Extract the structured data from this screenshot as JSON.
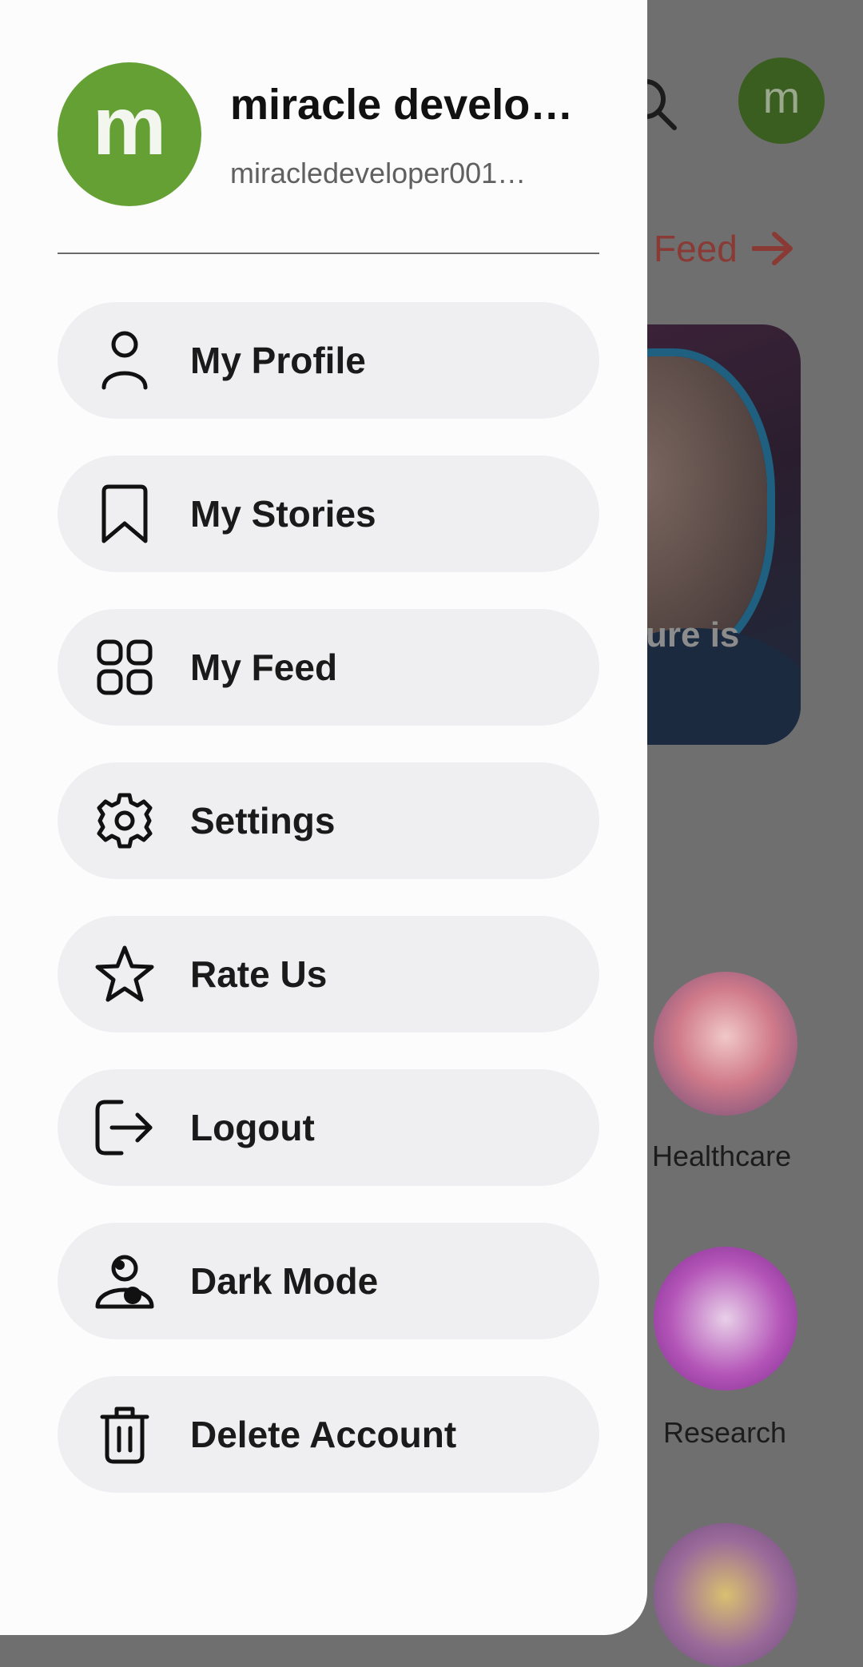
{
  "profile": {
    "avatar_letter": "m",
    "name": "miracle develo…",
    "email": "miracledeveloper001…"
  },
  "menu": [
    {
      "label": "My Profile",
      "icon": "person-icon"
    },
    {
      "label": "My Stories",
      "icon": "bookmark-icon"
    },
    {
      "label": "My Feed",
      "icon": "grid-icon"
    },
    {
      "label": "Settings",
      "icon": "gear-icon"
    },
    {
      "label": "Rate Us",
      "icon": "star-icon"
    },
    {
      "label": "Logout",
      "icon": "logout-icon"
    },
    {
      "label": "Dark Mode",
      "icon": "dark-mode-icon"
    },
    {
      "label": "Delete Account",
      "icon": "trash-icon"
    }
  ],
  "background": {
    "avatar_letter": "m",
    "feed_link": "Feed",
    "card_text": "ure is",
    "categories": [
      "Healthcare",
      "Research"
    ]
  },
  "colors": {
    "avatar_green": "#64a033",
    "menu_bg": "#efeff1",
    "scrim": "#6f6f6f",
    "link_red": "#8a3a34"
  }
}
